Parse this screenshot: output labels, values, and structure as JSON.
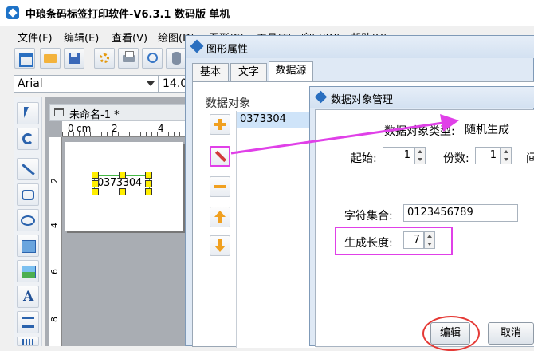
{
  "main_window": {
    "title": "中琅条码标签打印软件-V6.3.1 数码版 单机",
    "menu": [
      "文件(F)",
      "编辑(E)",
      "查看(V)",
      "绘图(D)",
      "图形(S)",
      "工具(T)",
      "窗口(W)",
      "帮助(H)"
    ],
    "font_name": "Arial",
    "font_size": "14.0"
  },
  "document": {
    "tab_title": "未命名-1 *",
    "ruler_unit": "cm",
    "ruler_h": [
      "0",
      "2",
      "4"
    ],
    "ruler_v": [
      "2",
      "4",
      "6",
      "8"
    ],
    "barcode_text": "0373304"
  },
  "shape_props": {
    "title": "图形属性",
    "tabs": [
      "基本",
      "文字",
      "数据源"
    ],
    "active_tab": "数据源",
    "group_label": "数据对象",
    "list_items": [
      "0373304"
    ]
  },
  "data_manager": {
    "title": "数据对象管理",
    "type_label": "数据对象类型:",
    "type_value": "随机生成",
    "start_label": "起始:",
    "start_value": "1",
    "copies_label": "份数:",
    "copies_value": "1",
    "interval_label": "间",
    "charset_label": "字符集合:",
    "charset_value": "0123456789",
    "length_label": "生成长度:",
    "length_value": "7",
    "edit_button": "编辑",
    "cancel_button": "取消"
  },
  "colors": {
    "highlight": "#e040e8",
    "circle": "#e53935",
    "selection": "#cfe4f9",
    "handle": "#ffee00"
  }
}
